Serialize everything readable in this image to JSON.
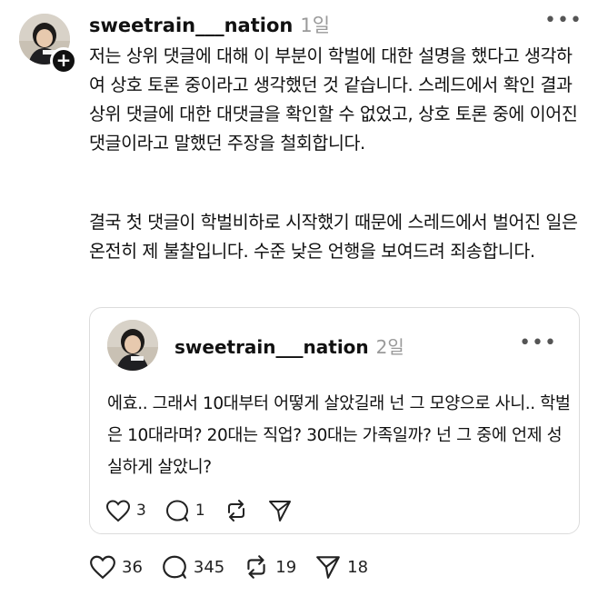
{
  "post": {
    "username": "sweetrain___nation",
    "timestamp": "1일",
    "more_label": "•••",
    "follow_label": "+",
    "paragraph1": "저는 상위 댓글에 대해 이 부분이 학벌에 대한 설명을 했다고 생각하여 상호 토론 중이라고 생각했던 것 같습니다. 스레드에서 확인 결과 상위 댓글에 대한 대댓글을 확인할 수 없었고, 상호 토론 중에 이어진 댓글이라고 말했던 주장을 철회합니다.",
    "paragraph2": "결국 첫 댓글이 학벌비하로 시작했기 때문에 스레드에서 벌어진 일은 온전히 제 불찰입니다. 수준 낮은 언행을 보여드려 죄송합니다.",
    "actions": {
      "likes": "36",
      "replies": "345",
      "reposts": "19",
      "shares": "18"
    }
  },
  "quoted_post": {
    "username": "sweetrain___nation",
    "timestamp": "2일",
    "more_label": "•••",
    "text": "에효.. 그래서 10대부터 어떻게 살았길래 넌 그 모양으로 사니.. 학벌은 10대라며? 20대는 직업? 30대는 가족일까? 넌 그 중에 언제 성실하게 살았니?",
    "actions": {
      "likes": "3",
      "replies": "1"
    }
  },
  "icons": {
    "heart": "heart-icon",
    "reply": "comment-icon",
    "repost": "repost-icon",
    "share": "send-icon"
  }
}
